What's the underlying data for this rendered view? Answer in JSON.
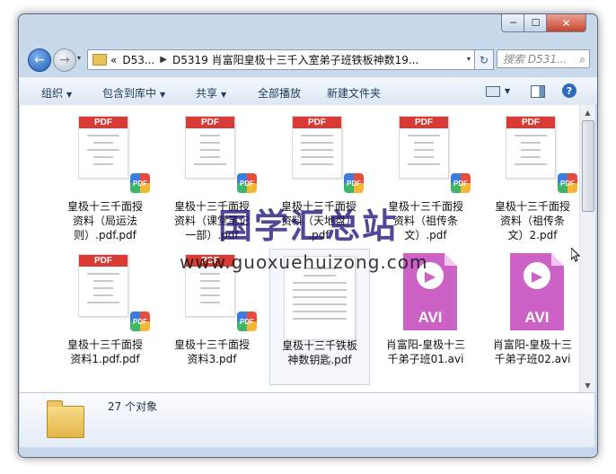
{
  "window": {
    "controls": {
      "minimize": "─",
      "maximize": "☐",
      "close": "✕"
    }
  },
  "nav": {
    "back_icon": "←",
    "forward_icon": "→",
    "dropdown_icon": "▾",
    "breadcrumb_prefix": "«",
    "breadcrumb": [
      "D53...",
      "D5319 肖富阳皇极十三千入室弟子班铁板神数19..."
    ],
    "refresh_icon": "↻",
    "search_placeholder": "搜索 D531...",
    "search_icon": "⌕"
  },
  "toolbar": {
    "organize": "组织",
    "include_library": "包含到库中",
    "share": "共享",
    "play_all": "全部播放",
    "new_folder": "新建文件夹",
    "help": "?"
  },
  "files": [
    {
      "name": "皇极十三千面授资料（局运法则）.pdf.pdf",
      "lines": [
        "皇极十三千面授",
        "资料（局运法",
        "则）.pdf.pdf"
      ],
      "type": "pdf"
    },
    {
      "name": "皇极十三千面授资料（课堂笔记一部）.pdf",
      "lines": [
        "皇极十三千面授",
        "资料（课堂笔记",
        "一部）.pdf"
      ],
      "type": "pdf"
    },
    {
      "name": "皇极十三千面授资料（天地盘）.pdf",
      "lines": [
        "皇极十三千面授",
        "资料（天地盘）",
        ".pdf"
      ],
      "type": "pdf"
    },
    {
      "name": "皇极十三千面授资料（祖传条文）.pdf",
      "lines": [
        "皇极十三千面授",
        "资料（祖传条",
        "文）.pdf"
      ],
      "type": "pdf"
    },
    {
      "name": "皇极十三千面授资料（祖传条文）2.pdf",
      "lines": [
        "皇极十三千面授",
        "资料（祖传条",
        "文）2.pdf"
      ],
      "type": "pdf"
    },
    {
      "name": "皇极十三千面授资料1.pdf.pdf",
      "lines": [
        "皇极十三千面授",
        "资料1.pdf.pdf"
      ],
      "type": "pdf"
    },
    {
      "name": "皇极十三千面授资料3.pdf",
      "lines": [
        "皇极十三千面授",
        "资料3.pdf"
      ],
      "type": "pdf"
    },
    {
      "name": "皇极十三千铁板神数钥匙.pdf",
      "lines": [
        "皇极十三千铁板",
        "神数钥匙.pdf"
      ],
      "type": "pdf-big"
    },
    {
      "name": "肖富阳-皇极十三千弟子班01.avi",
      "lines": [
        "肖富阳-皇极十三",
        "千弟子班01.avi"
      ],
      "type": "avi"
    },
    {
      "name": "肖富阳-皇极十三千弟子班02.avi",
      "lines": [
        "肖富阳-皇极十三",
        "千弟子班02.avi"
      ],
      "type": "avi"
    }
  ],
  "badges": {
    "pdf_band": "PDF",
    "pdf_badge": "PDF",
    "avi_label": "AVI",
    "play_icon": "▶"
  },
  "status": {
    "count": "27 个对象"
  },
  "watermark": {
    "text": "国学汇总站",
    "url": "www.guoxuehuizong.com"
  },
  "scroll": {
    "up": "▲",
    "down": "▼"
  }
}
